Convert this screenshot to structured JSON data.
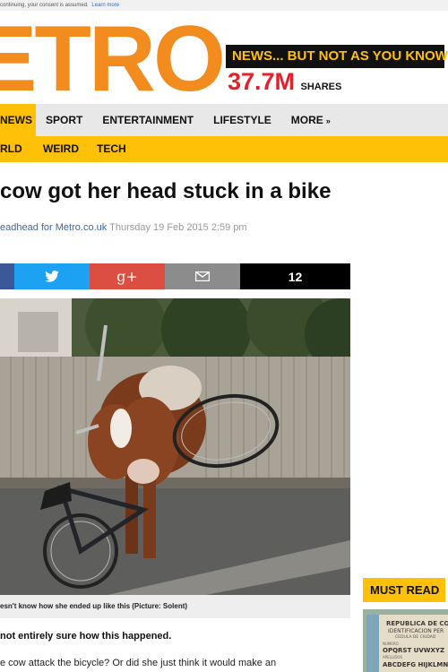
{
  "cookie_bar": {
    "text": "continuing, your consent is assumed.",
    "more_link": "Learn more"
  },
  "masthead": {
    "logo": "ETRO",
    "tagline": "NEWS... BUT NOT AS YOU KNOW IT",
    "shares_count": "37.7M",
    "shares_label": "SHARES"
  },
  "nav": {
    "items": [
      {
        "label": "NEWS"
      },
      {
        "label": "SPORT"
      },
      {
        "label": "ENTERTAINMENT"
      },
      {
        "label": "LIFESTYLE"
      },
      {
        "label": "MORE"
      }
    ]
  },
  "subnav": {
    "items": [
      {
        "label": "RLD"
      },
      {
        "label": "WEIRD"
      },
      {
        "label": "TECH"
      }
    ]
  },
  "article": {
    "headline": "cow got her head stuck in a bike",
    "author": "eadhead for Metro.co.uk",
    "date": "Thursday 19 Feb 2015 2:59 pm",
    "share_count": "12",
    "caption": "esn't know how she ended up like this (Picture: Solent)",
    "para1": "not entirely sure how this happened.",
    "para2": "e cow attack the bicycle? Or did she just think it would make an"
  },
  "sidebar": {
    "must_read": "MUST READ",
    "card_text": [
      "REPUBLICA DE COL",
      "IDENTIFICACION PER",
      "CEDULA DE CIUDAD",
      "NUMERO",
      "OPQRST UVWXYZ",
      "APELLIDOS",
      "ABCDEFG HIJKLMN"
    ]
  },
  "colors": {
    "brand_orange": "#f28c1e",
    "nav_yellow": "#ffc107",
    "shares_red": "#e4202b"
  }
}
